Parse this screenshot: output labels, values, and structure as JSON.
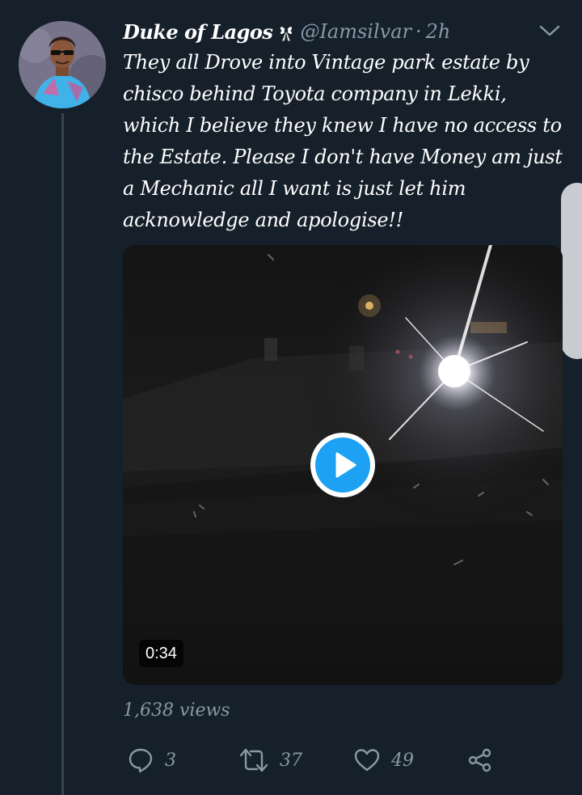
{
  "tweet": {
    "author": {
      "display_name": "Duke of Lagos",
      "emoji": "ribbon-emoji",
      "handle": "@Iamsilvar",
      "time": "2h"
    },
    "separator": "·",
    "text": "They all Drove into Vintage park estate by chisco behind Toyota company in Lekki, which I believe they knew I have no access to the Estate. Please I don't have Money am just a Mechanic all I want is just let him acknowledge and apologise!!",
    "media": {
      "type": "video",
      "duration": "0:34",
      "play_icon": "play-icon"
    },
    "views": "1,638 views",
    "actions": {
      "reply": {
        "icon": "reply-icon",
        "count": "3"
      },
      "retweet": {
        "icon": "retweet-icon",
        "count": "37"
      },
      "like": {
        "icon": "heart-icon",
        "count": "49"
      },
      "share": {
        "icon": "share-icon"
      }
    }
  },
  "colors": {
    "background": "#15202b",
    "secondary_text": "#8899a6",
    "accent": "#1da1f2",
    "thread_line": "#38444d"
  }
}
